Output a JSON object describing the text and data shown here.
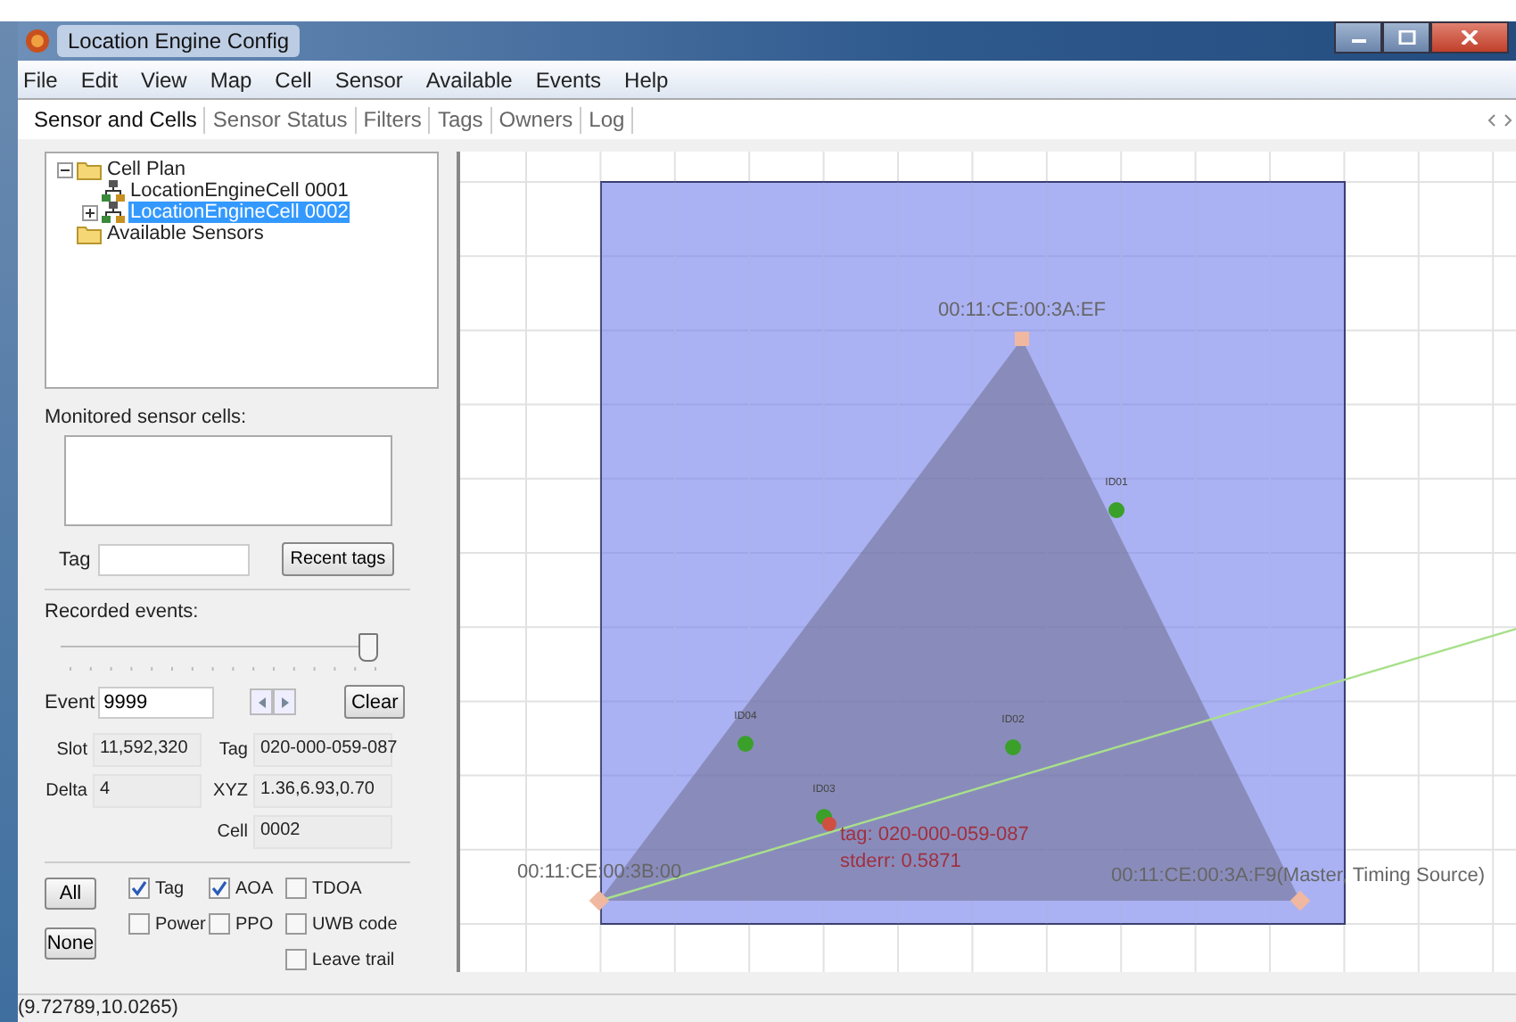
{
  "window": {
    "title": "Location Engine Config"
  },
  "menu": [
    "File",
    "Edit",
    "View",
    "Map",
    "Cell",
    "Sensor",
    "Available",
    "Events",
    "Help"
  ],
  "tabs": [
    {
      "label": "Sensor and Cells",
      "selected": true
    },
    {
      "label": "Sensor Status",
      "selected": false
    },
    {
      "label": "Filters",
      "selected": false
    },
    {
      "label": "Tags",
      "selected": false
    },
    {
      "label": "Owners",
      "selected": false
    },
    {
      "label": "Log",
      "selected": false
    }
  ],
  "tree": [
    {
      "label": "Cell Plan",
      "kind": "folder",
      "expanded": true,
      "selected": false,
      "children": [
        {
          "label": "LocationEngineCell 0001",
          "kind": "cell",
          "selected": false
        },
        {
          "label": "LocationEngineCell 0002",
          "kind": "cell",
          "expanded": false,
          "selected": true
        }
      ]
    },
    {
      "label": "Available Sensors",
      "kind": "folder",
      "selected": false
    }
  ],
  "monitored": {
    "label": "Monitored sensor cells:"
  },
  "tag_field": {
    "label": "Tag"
  },
  "recent_tags_button": "Recent tags",
  "recorded": {
    "label": "Recorded events:",
    "level": 0.97
  },
  "event": {
    "label": "Event",
    "value": "9999"
  },
  "clear_button": "Clear",
  "info": [
    {
      "label": "Slot",
      "value": "11,592,320"
    },
    {
      "label": "Tag",
      "value": "020-000-059-087"
    },
    {
      "label": "Delta",
      "value": "4"
    },
    {
      "label": "XYZ",
      "value": "1.36,6.93,0.70"
    },
    {
      "label": "Cell",
      "value": "0002"
    }
  ],
  "select_buttons": [
    "All",
    "None"
  ],
  "checkboxes": [
    {
      "label": "Tag",
      "checked": true
    },
    {
      "label": "AOA",
      "checked": true
    },
    {
      "label": "TDOA",
      "checked": false
    },
    {
      "label": "Power",
      "checked": false
    },
    {
      "label": "PPO",
      "checked": false
    },
    {
      "label": "UWB code",
      "checked": false
    },
    {
      "label": "Leave trail",
      "checked": false
    }
  ],
  "map": {
    "sensors": [
      {
        "label": "00:11:CE:00:3A:EF"
      },
      {
        "label": "00:11:CE:00:3B:00"
      },
      {
        "label": "00:11:CE:00:3A:F9(Master, Timing Source)"
      }
    ],
    "tags": [
      {
        "label": "ID01"
      },
      {
        "label": "ID04"
      },
      {
        "label": "ID02"
      },
      {
        "label": "ID03"
      }
    ],
    "located": {
      "tag": "tag: 020-000-059-087",
      "stderr": "stderr: 0.5871"
    }
  },
  "status_bar": "(9.72789,10.0265)"
}
